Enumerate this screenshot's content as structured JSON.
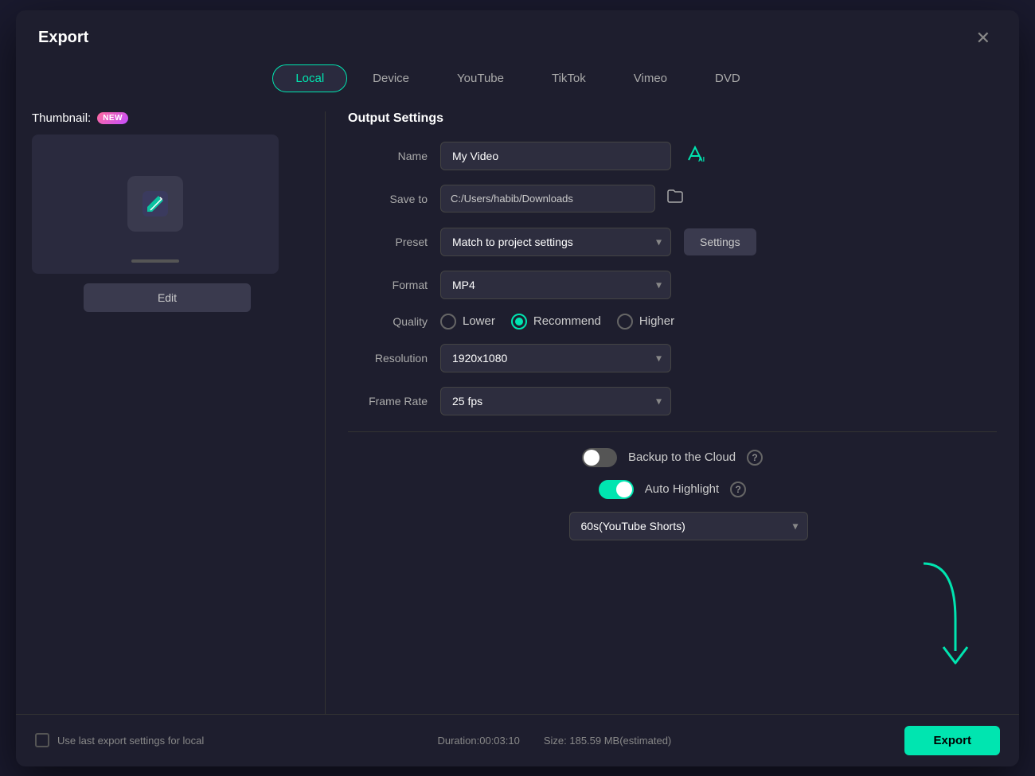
{
  "dialog": {
    "title": "Export",
    "close_label": "✕"
  },
  "tabs": [
    {
      "id": "local",
      "label": "Local",
      "active": true
    },
    {
      "id": "device",
      "label": "Device",
      "active": false
    },
    {
      "id": "youtube",
      "label": "YouTube",
      "active": false
    },
    {
      "id": "tiktok",
      "label": "TikTok",
      "active": false
    },
    {
      "id": "vimeo",
      "label": "Vimeo",
      "active": false
    },
    {
      "id": "dvd",
      "label": "DVD",
      "active": false
    }
  ],
  "thumbnail": {
    "label": "Thumbnail:",
    "new_badge": "NEW",
    "edit_button": "Edit"
  },
  "output_settings": {
    "section_title": "Output Settings",
    "name_label": "Name",
    "name_value": "My Video",
    "save_to_label": "Save to",
    "save_to_value": "C:/Users/habib/Downloads",
    "preset_label": "Preset",
    "preset_value": "Match to project settings",
    "settings_button": "Settings",
    "format_label": "Format",
    "format_value": "MP4",
    "quality_label": "Quality",
    "quality_options": [
      {
        "id": "lower",
        "label": "Lower",
        "selected": false
      },
      {
        "id": "recommend",
        "label": "Recommend",
        "selected": true
      },
      {
        "id": "higher",
        "label": "Higher",
        "selected": false
      }
    ],
    "resolution_label": "Resolution",
    "resolution_value": "1920x1080",
    "frame_rate_label": "Frame Rate",
    "frame_rate_value": "25 fps",
    "backup_label": "Backup to the Cloud",
    "auto_highlight_label": "Auto Highlight",
    "youtube_shorts_value": "60s(YouTube Shorts)"
  },
  "footer": {
    "checkbox_label": "Use last export settings for local",
    "duration_label": "Duration:00:03:10",
    "size_label": "Size: 185.59 MB(estimated)",
    "export_button": "Export"
  }
}
